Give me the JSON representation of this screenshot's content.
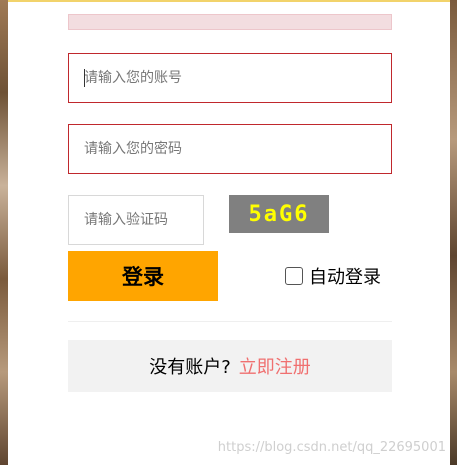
{
  "form": {
    "account_placeholder": "请输入您的账号",
    "password_placeholder": "请输入您的密码",
    "captcha_placeholder": "请输入验证码",
    "captcha_text": "5aG6",
    "login_label": "登录",
    "auto_login_label": "自动登录",
    "no_account_text": "没有账户?",
    "register_link": "立即注册"
  },
  "watermark": "https://blog.csdn.net/qq_22695001",
  "colors": {
    "accent": "#ffa500",
    "error_border": "#c0282d",
    "link": "#f07070",
    "captcha_bg": "#808080",
    "captcha_text": "#ffff00"
  }
}
